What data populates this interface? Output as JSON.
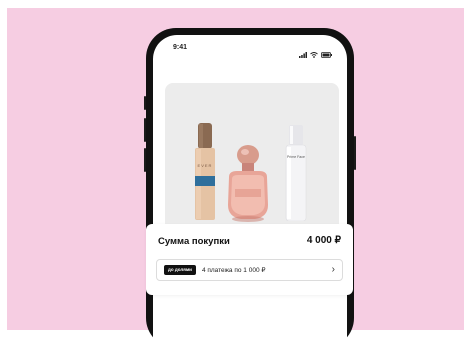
{
  "status_bar": {
    "time": "9:41"
  },
  "products": {
    "foundation_label": "EVER",
    "serum_label": "Prime Face"
  },
  "purchase": {
    "sum_label": "Сумма покупки",
    "sum_value": "4 000 ₽",
    "badge": "до долями",
    "installments_text": "4 платежа по 1 000 ₽",
    "chevron": "›"
  },
  "colors": {
    "background": "#f6cde2",
    "phone_frame": "#111111",
    "card_bg": "#ececec",
    "badge_bg": "#111111"
  }
}
